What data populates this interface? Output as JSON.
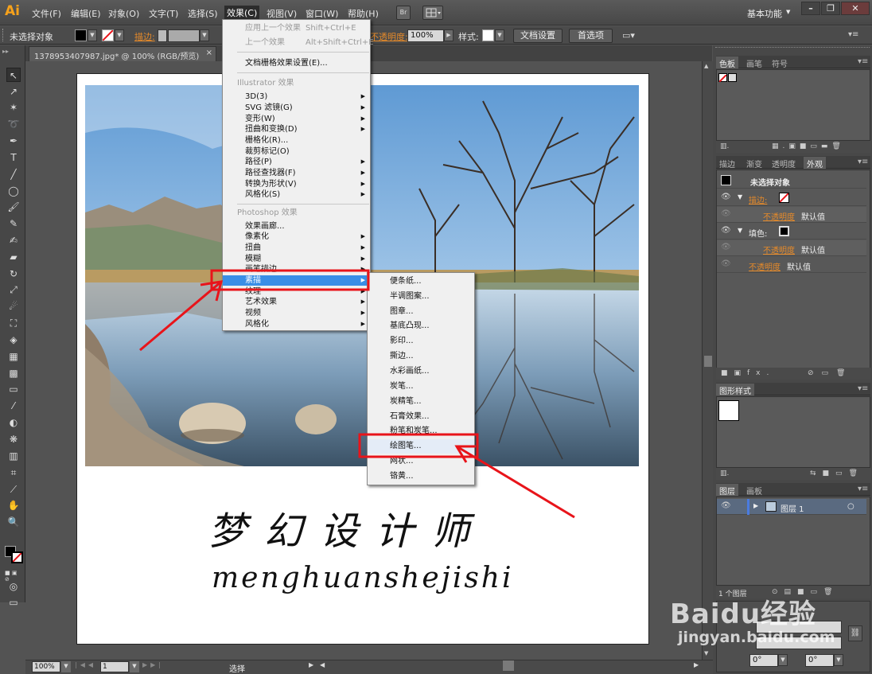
{
  "app": {
    "logo": "Ai",
    "menus": [
      "文件(F)",
      "编辑(E)",
      "对象(O)",
      "文字(T)",
      "选择(S)",
      "效果(C)",
      "视图(V)",
      "窗口(W)",
      "帮助(H)"
    ],
    "bridge_label": "Br",
    "workspace": "基本功能",
    "window_buttons": [
      "–",
      "❐",
      "✕"
    ]
  },
  "control_bar": {
    "selection_label": "未选择对象",
    "stroke_label": "描边:",
    "opacity_label": "不透明度:",
    "opacity_value": "100%",
    "style_label": "样式:",
    "doc_settings_button": "文档设置",
    "preferences_button": "首选项"
  },
  "document": {
    "tab_title": "1378953407987.jpg* @ 100% (RGB/预览)",
    "close_glyph": "×",
    "artwork_title": "梦幻设计师",
    "artwork_subtitle": "menghuanshejishi"
  },
  "effect_menu": {
    "apply_last": "应用上一个效果",
    "apply_last_shortcut": "Shift+Ctrl+E",
    "last_effect": "上一个效果",
    "last_effect_shortcut": "Alt+Shift+Ctrl+E",
    "raster_settings": "文档栅格效果设置(E)...",
    "illustrator_header": "Illustrator 效果",
    "illustrator_items": [
      "3D(3)",
      "SVG 滤镜(G)",
      "变形(W)",
      "扭曲和变换(D)",
      "栅格化(R)...",
      "裁剪标记(O)",
      "路径(P)",
      "路径查找器(F)",
      "转换为形状(V)",
      "风格化(S)"
    ],
    "photoshop_header": "Photoshop 效果",
    "photoshop_items": [
      "效果画廊...",
      "像素化",
      "扭曲",
      "模糊",
      "画笔描边",
      "素描",
      "纹理",
      "艺术效果",
      "视频",
      "风格化"
    ],
    "highlighted": "素描"
  },
  "sketch_submenu": {
    "items": [
      "便条纸...",
      "半调图案...",
      "图章...",
      "基底凸现...",
      "影印...",
      "撕边...",
      "水彩画纸...",
      "炭笔...",
      "炭精笔...",
      "石膏效果...",
      "粉笔和炭笔...",
      "绘图笔...",
      "网状...",
      "铬黄..."
    ],
    "target": "绘图笔..."
  },
  "panels": {
    "swatch_tabs": [
      "色板",
      "画笔",
      "符号"
    ],
    "appearance_tabs": [
      "描边",
      "渐变",
      "透明度",
      "外观"
    ],
    "appearance": {
      "title": "未选择对象",
      "stroke_label": "描边:",
      "fill_label": "填色:",
      "opacity_label": "不透明度",
      "opacity_value": "默认值"
    },
    "graphic_styles_tab": "图形样式",
    "layers_tabs": [
      "图层",
      "画板"
    ],
    "layer_name": "图层 1",
    "layers_count": "1 个图层",
    "angle_value_1": "0°",
    "angle_value_2": "0°"
  },
  "status_bar": {
    "zoom": "100%",
    "page": "1",
    "mode": "选择"
  },
  "watermark": {
    "brand": "Baidu经验",
    "url": "jingyan.baidu.com"
  },
  "annotation_color": "#e8141a",
  "highlight_color": "#3a8ee6"
}
